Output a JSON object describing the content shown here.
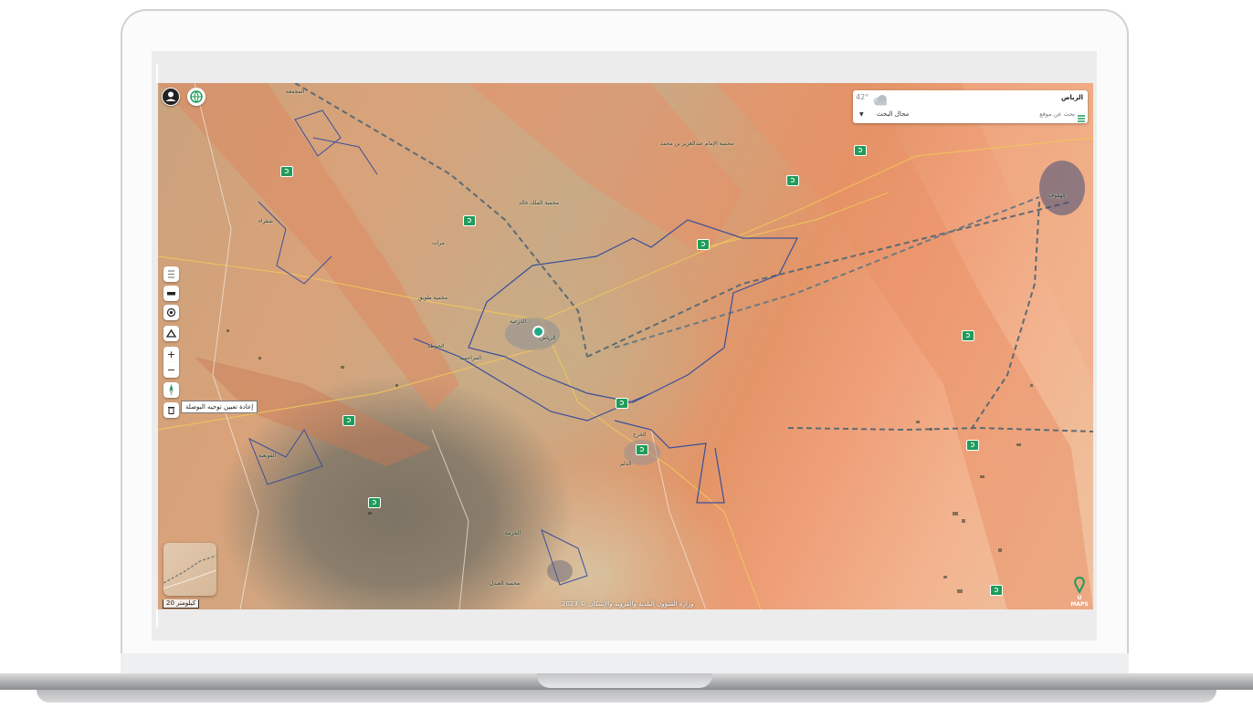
{
  "search": {
    "city": "الرياض",
    "placeholder": "بحث عن موقع",
    "field_label": "مجال البحث",
    "temperature": "42°"
  },
  "tooltip": {
    "text": "إعادة تعيين توجيه البوصلة"
  },
  "controls": {
    "zoom_in": "+",
    "zoom_out": "−"
  },
  "scale": {
    "text": "20 كيلومتر"
  },
  "attribution": {
    "text": "وزارة الشؤون البلدية والقروية والإسكان © 2023"
  },
  "logo": {
    "text": "U MAPS"
  },
  "map_labels": [
    "محمية الإمام عبدالعزيز بن محمد",
    "محمية الملك خالد",
    "محمية طويق",
    "الرياض",
    "الدرعية",
    "الحوطة",
    "الدلم",
    "محمية العبدل",
    "الخرج",
    "المزاحمية",
    "القويعية",
    "المجمعة",
    "الهفوف",
    "شقراء",
    "الخرمة",
    "مرات"
  ],
  "colors": {
    "poi_green": "#1f9c5a",
    "boundary_blue": "#3a4f9a",
    "menu_icon": "#1f9c5a"
  },
  "icons": [
    "user-icon",
    "globe-icon",
    "list-icon",
    "layer-icon",
    "locate-icon",
    "home-icon",
    "zoom-in-icon",
    "zoom-out-icon",
    "compass-icon",
    "trash-icon",
    "weather-cloud-icon",
    "menu-icon",
    "chevron-down-icon",
    "poi-marker-icon",
    "location-pin-icon"
  ]
}
